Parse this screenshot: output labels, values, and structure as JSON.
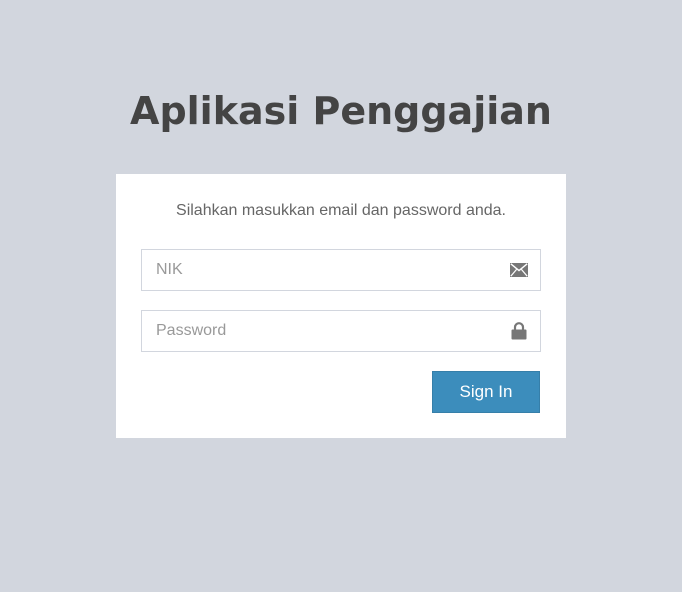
{
  "app": {
    "title": "Aplikasi Penggajian"
  },
  "login": {
    "message": "Silahkan masukkan email dan password anda.",
    "nik_field": {
      "value": "",
      "placeholder": "NIK",
      "icon": "envelope-icon"
    },
    "password_field": {
      "value": "",
      "placeholder": "Password",
      "icon": "lock-icon"
    },
    "signin_label": "Sign In"
  },
  "colors": {
    "background": "#d2d6de",
    "box": "#ffffff",
    "title_text": "#444444",
    "primary_button": "#3c8dbc",
    "icon": "#777777"
  }
}
